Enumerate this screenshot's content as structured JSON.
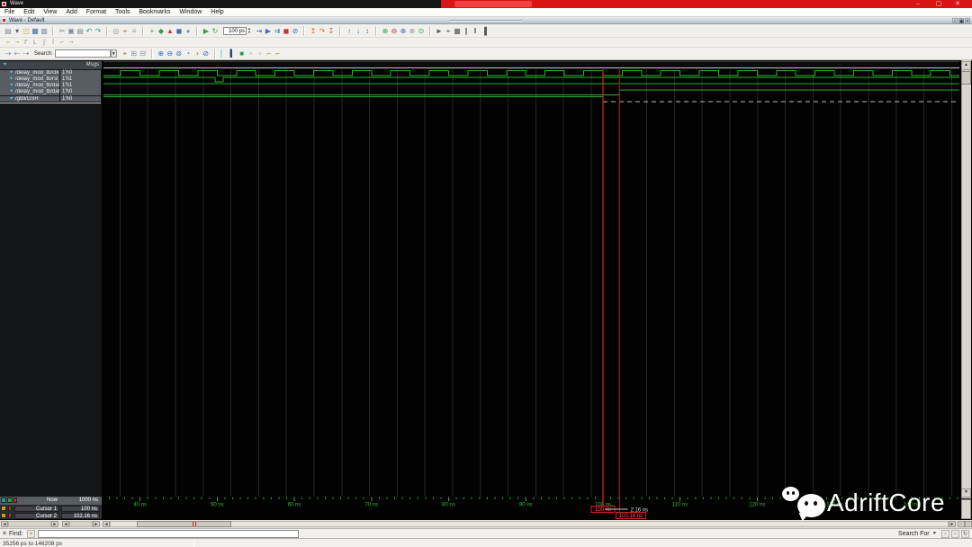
{
  "titlebar": {
    "title": "Wave",
    "minimize": "–",
    "maximize": "▢",
    "close": "✕",
    "overlay_color": "#d81414"
  },
  "menubar": {
    "items": [
      "File",
      "Edit",
      "View",
      "Add",
      "Format",
      "Tools",
      "Bookmarks",
      "Window",
      "Help"
    ]
  },
  "mdi_tab": {
    "label": "Wave - Default",
    "buttons": [
      "+",
      "▣",
      "✕"
    ]
  },
  "toolbars": {
    "spin_value": "100 ps",
    "search_label": "Search:",
    "row1": [
      {
        "type": "icons",
        "icons": [
          {
            "n": "new-file-icon",
            "g": "▤",
            "c": "#7c8aa0"
          },
          {
            "n": "new-dropdown-icon",
            "g": "▾",
            "c": "#555555"
          },
          {
            "n": "open-icon",
            "g": "◰",
            "c": "#c9a23a"
          },
          {
            "n": "save-icon",
            "g": "▦",
            "c": "#3d6fb4"
          },
          {
            "n": "print-icon",
            "g": "▩",
            "c": "#8d98a8"
          }
        ]
      },
      {
        "type": "sep"
      },
      {
        "type": "icons",
        "icons": [
          {
            "n": "cut-icon",
            "g": "✂",
            "c": "#6a7684"
          },
          {
            "n": "copy-icon",
            "g": "▣",
            "c": "#7c8aa0"
          },
          {
            "n": "paste-icon",
            "g": "▤",
            "c": "#7c8aa0"
          },
          {
            "n": "undo-icon",
            "g": "↶",
            "c": "#2a9d8f"
          },
          {
            "n": "redo-icon",
            "g": "↷",
            "c": "#2a9d8f"
          }
        ]
      },
      {
        "type": "sep"
      },
      {
        "type": "icons",
        "icons": [
          {
            "n": "reload-icon",
            "g": "◎",
            "c": "#8d98a8"
          },
          {
            "n": "find-icon",
            "g": "⌖",
            "c": "#a07820"
          },
          {
            "n": "filter-icon",
            "g": "≡",
            "c": "#8d98a8"
          }
        ]
      },
      {
        "type": "sep"
      },
      {
        "type": "icons",
        "icons": [
          {
            "n": "add-wave-icon",
            "g": "+",
            "c": "#2f9e44"
          },
          {
            "n": "add-group-icon",
            "g": "◆",
            "c": "#2f9e44"
          },
          {
            "n": "delete-wave-icon",
            "g": "▲",
            "c": "#c03535"
          },
          {
            "n": "insert-blank-icon",
            "g": "◼",
            "c": "#3d6fb4"
          },
          {
            "n": "mode-icon",
            "g": "●",
            "c": "#8d98a8"
          }
        ]
      },
      {
        "type": "sep"
      },
      {
        "type": "icons",
        "icons": [
          {
            "n": "simulate-icon",
            "g": "▶",
            "c": "#2f9e44"
          },
          {
            "n": "restart-icon",
            "g": "↻",
            "c": "#2f9e44"
          }
        ]
      },
      {
        "type": "spin"
      },
      {
        "type": "icons",
        "icons": [
          {
            "n": "run-icon",
            "g": "⇥",
            "c": "#3d6fb4"
          },
          {
            "n": "continue-run-icon",
            "g": "▶",
            "c": "#3d6fb4"
          },
          {
            "n": "run-all-icon",
            "g": "⇉",
            "c": "#3d6fb4"
          },
          {
            "n": "break-icon",
            "g": "◼",
            "c": "#c03535"
          },
          {
            "n": "stop-icon",
            "g": "⊘",
            "c": "#3d6fb4"
          }
        ]
      },
      {
        "type": "sep"
      },
      {
        "type": "icons",
        "icons": [
          {
            "n": "step-icon",
            "g": "↥",
            "c": "#d2691e"
          },
          {
            "n": "step-over-icon",
            "g": "↷",
            "c": "#d2691e"
          },
          {
            "n": "step-out-icon",
            "g": "↧",
            "c": "#d2691e"
          }
        ]
      },
      {
        "type": "sep"
      },
      {
        "type": "icons",
        "icons": [
          {
            "n": "prev-transition-icon",
            "g": "↑",
            "c": "#3d6fb4"
          },
          {
            "n": "next-transition-icon",
            "g": "↓",
            "c": "#3d6fb4"
          },
          {
            "n": "edge-search-icon",
            "g": "↕",
            "c": "#3d6fb4"
          }
        ]
      },
      {
        "type": "sep"
      },
      {
        "type": "icons",
        "icons": [
          {
            "n": "zoom-in-icon",
            "g": "⊕",
            "c": "#2f9e44"
          },
          {
            "n": "zoom-out-icon",
            "g": "⊖",
            "c": "#c03535"
          },
          {
            "n": "zoom-full-icon",
            "g": "⊕",
            "c": "#3d6fb4"
          },
          {
            "n": "zoom-mode-icon",
            "g": "⊗",
            "c": "#8d98a8"
          },
          {
            "n": "zoom-range-icon",
            "g": "⊙",
            "c": "#2f9e44"
          }
        ]
      },
      {
        "type": "sep"
      },
      {
        "type": "icons",
        "icons": [
          {
            "n": "select-mode-icon",
            "g": "►",
            "c": "#555555"
          },
          {
            "n": "zoom-cursor-icon",
            "g": "⌖",
            "c": "#555555"
          },
          {
            "n": "grid-icon",
            "g": "▦",
            "c": "#555555"
          },
          {
            "n": "expand-time-icon",
            "g": "∥",
            "c": "#555555"
          },
          {
            "n": "collapse-time-icon",
            "g": "‖",
            "c": "#555555"
          },
          {
            "n": "leaf-view-icon",
            "g": "▐",
            "c": "#555555"
          }
        ]
      }
    ],
    "row2": [
      {
        "type": "icons",
        "icons": [
          {
            "n": "wave-edit-cursor-icon",
            "g": "⌐",
            "c": "#a8921f"
          },
          {
            "n": "wave-edit-paste-icon",
            "g": "¬",
            "c": "#a8921f"
          },
          {
            "n": "wave-edit-invert-icon",
            "g": "Γ",
            "c": "#8f8f66"
          },
          {
            "n": "wave-edit-mirror-icon",
            "g": "L",
            "c": "#8f8f66"
          },
          {
            "n": "wave-edit-stretch-icon",
            "g": "ʃ",
            "c": "#8f8f66"
          },
          {
            "n": "wave-edit-cut-icon",
            "g": "ſ",
            "c": "#8f8f66"
          },
          {
            "n": "wave-edit-insert-icon",
            "g": "⌐",
            "c": "#8f8f66"
          },
          {
            "n": "wave-edit-delete-icon",
            "g": "¬",
            "c": "#8f8f66"
          }
        ]
      }
    ],
    "row3": [
      {
        "type": "icons",
        "icons": [
          {
            "n": "goto-time-icon",
            "g": "⇢",
            "c": "#7a8aa8"
          },
          {
            "n": "back-icon",
            "g": "⇠",
            "c": "#7a8aa8"
          },
          {
            "n": "forward-icon",
            "g": "⇢",
            "c": "#7a8aa8"
          }
        ]
      },
      {
        "type": "search"
      },
      {
        "type": "icons",
        "icons": [
          {
            "n": "search-binoculars-icon",
            "g": "⌖",
            "c": "#a07820"
          },
          {
            "n": "search-options-icon",
            "g": "⊞",
            "c": "#8d98a8"
          },
          {
            "n": "search-regexp-icon",
            "g": "⊟",
            "c": "#8d98a8"
          }
        ]
      },
      {
        "type": "sep"
      },
      {
        "type": "icons",
        "icons": [
          {
            "n": "zoom-in-tool-icon",
            "g": "⊕",
            "c": "#3a6ec0"
          },
          {
            "n": "zoom-out-tool-icon",
            "g": "⊖",
            "c": "#3a6ec0"
          },
          {
            "n": "zoom-fit-icon",
            "g": "⊚",
            "c": "#3a6ec0"
          },
          {
            "n": "zoom-last-icon",
            "g": "◔",
            "c": "#3a6ec0"
          },
          {
            "n": "zoom-range-tool-icon",
            "g": "◑",
            "c": "#caa53a"
          },
          {
            "n": "zoom-others-icon",
            "g": "⊘",
            "c": "#3a6ec0"
          }
        ]
      },
      {
        "type": "sep"
      },
      {
        "type": "icons",
        "icons": [
          {
            "n": "insert-cursor-icon",
            "g": "▏",
            "c": "#3ac8d8"
          },
          {
            "n": "delete-cursor-icon",
            "g": "▍",
            "c": "#26406e"
          },
          {
            "n": "lock-cursor-icon",
            "g": "■",
            "c": "#2f9e44"
          },
          {
            "n": "placeholder-a-icon",
            "g": "▫",
            "c": "#999999"
          },
          {
            "n": "placeholder-b-icon",
            "g": "▫",
            "c": "#999999"
          },
          {
            "n": "prev-edge-icon",
            "g": "⌐",
            "c": "#a8921f"
          },
          {
            "n": "next-edge-icon",
            "g": "⌐",
            "c": "#a8921f"
          }
        ]
      }
    ]
  },
  "signals_panel": {
    "header_msgs": "Msgs",
    "signals": [
      {
        "name": "/delay_mod_tb/clk",
        "value": "1'h0"
      },
      {
        "name": "/delay_mod_tb/rst_n",
        "value": "1'h1"
      },
      {
        "name": "/delay_mod_tb/dat_i",
        "value": "1'h1"
      },
      {
        "name": "/delay_mod_tb/dat_o",
        "value": "1'h0"
      },
      {
        "name": "/glbl/GSR",
        "value": "1'h0"
      }
    ]
  },
  "cursor_panel": {
    "now_label": "Now",
    "now_value": "1000 ns",
    "cursors": [
      {
        "label": "Cursor 1",
        "value": "100 ns"
      },
      {
        "label": "Cursor 2",
        "value": "102.16 ns"
      }
    ],
    "delta": "2.16 ns"
  },
  "timeline": {
    "labels": [
      "40 ns",
      "50 ns",
      "60 ns",
      "70 ns",
      "80 ns",
      "90 ns",
      "100 ns",
      "110 ns",
      "120 ns",
      "130 ns",
      "140 ns"
    ],
    "tick_color": "#1fa01f",
    "label_color": "#2fbf2f"
  },
  "waveform": {
    "view_start_ns": 35.256,
    "view_end_ns": 146.208,
    "cursors_ns": [
      100,
      102.16
    ],
    "wave_color": "#25b025",
    "grid_color": "#262626",
    "cursor1_color": "#ff2a2a",
    "cursor2_color": "#8a2222",
    "nodata_color": "#b8bcbc",
    "rows": [
      {
        "name": "clk",
        "kind": "clock",
        "period_ns": 5
      },
      {
        "name": "rst_n",
        "kind": "step",
        "initial": 1,
        "edges": [
          [
            49.7,
            0
          ],
          [
            50.8,
            1
          ]
        ]
      },
      {
        "name": "dat_i",
        "kind": "step",
        "initial": 1,
        "edges": []
      },
      {
        "name": "dat_o",
        "kind": "step",
        "initial": 0,
        "edges": [
          [
            102.16,
            1
          ]
        ]
      },
      {
        "name": "gsr",
        "kind": "step",
        "initial": 1,
        "edges": [],
        "solid_until_ns": 100,
        "tail": "dashed-low"
      }
    ]
  },
  "findbar": {
    "close": "✕",
    "label": "Find:",
    "binoculars": "⌖",
    "search_for_label": "Search For",
    "caret": "▼",
    "buttons": [
      "▫",
      "▫",
      "↻"
    ]
  },
  "statusbar": {
    "range_text": "35256 ps to 146208 ps"
  },
  "watermark": {
    "text": "AdriftCore"
  }
}
